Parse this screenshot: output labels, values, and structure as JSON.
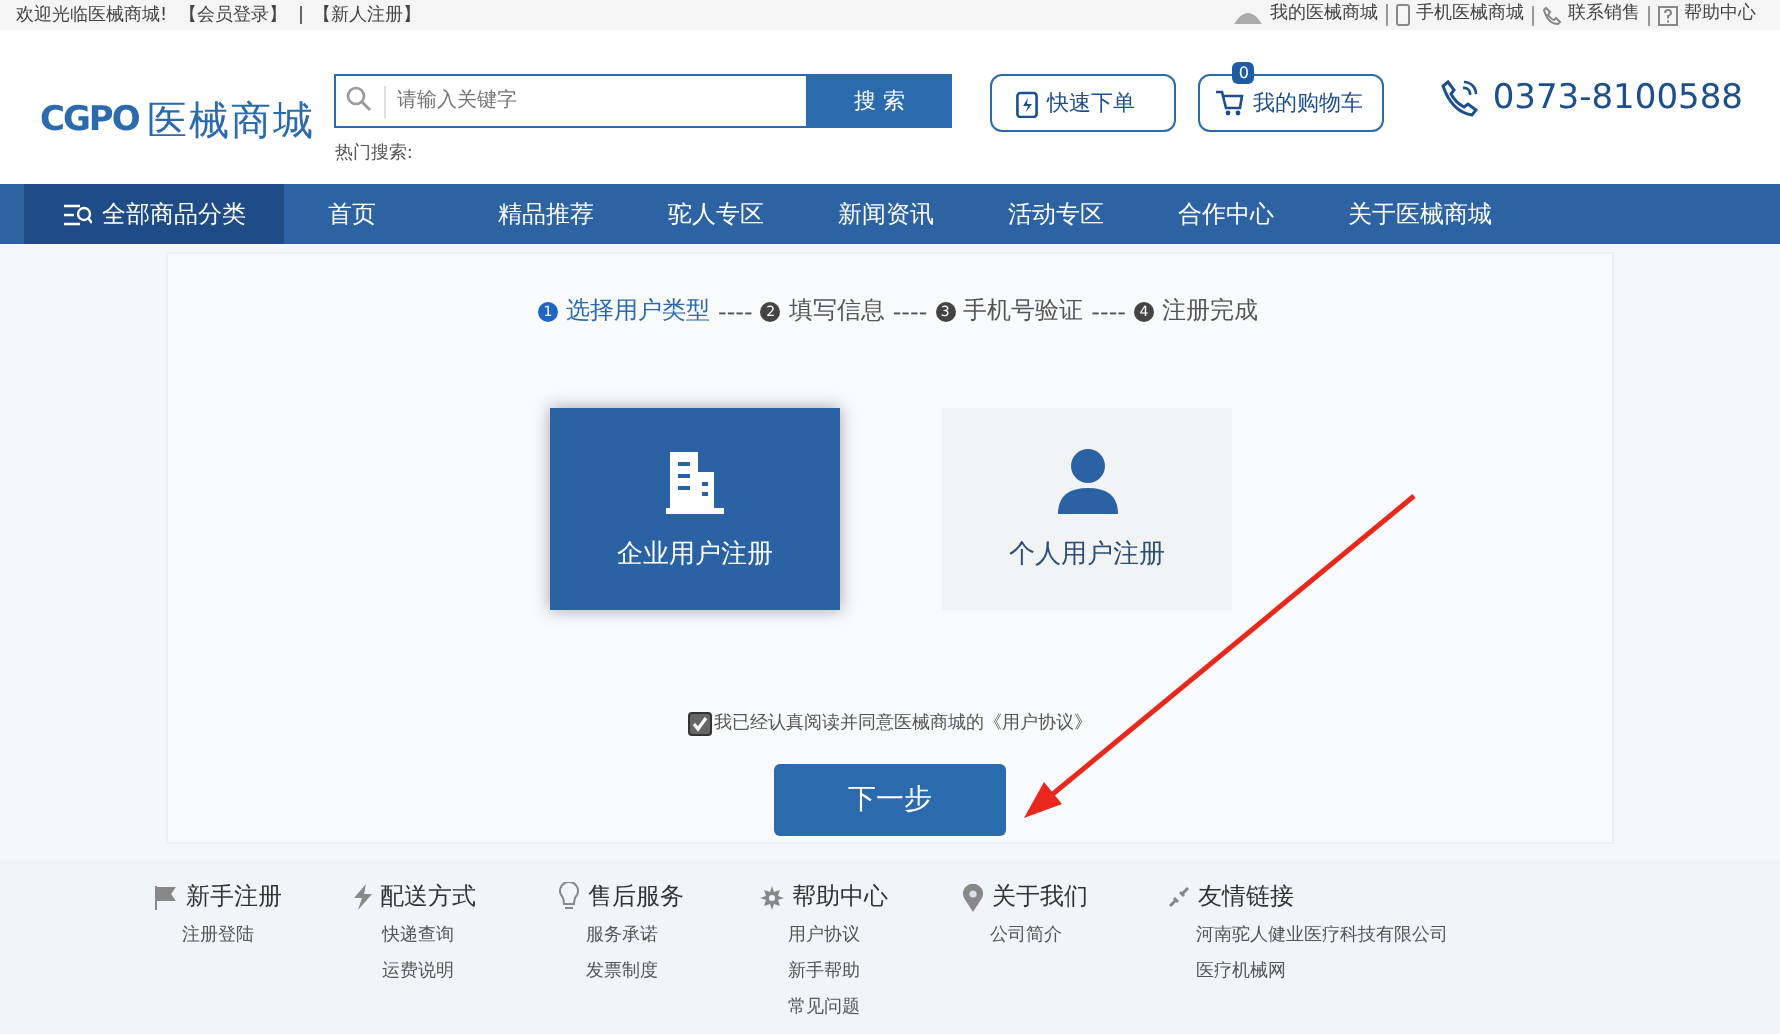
{
  "top_bar": {
    "welcome": "欢迎光临医械商城!",
    "left_links": [
      "【会员登录】",
      "【新人注册】"
    ],
    "right_links": [
      {
        "kind": "account",
        "label": "我的医械商城"
      },
      {
        "kind": "mobile",
        "label": "手机医械商城"
      },
      {
        "kind": "phone",
        "label": "联系销售"
      },
      {
        "kind": "help",
        "label": "帮助中心"
      }
    ]
  },
  "header": {
    "logo": {
      "mark": "CGPO",
      "name": "医械商城"
    },
    "search": {
      "placeholder": "请输入关键字",
      "button": "搜 索",
      "hot_label": "热门搜索:"
    },
    "quick_order": "快速下单",
    "cart": {
      "label": "我的购物车",
      "count": "0"
    },
    "phone": "0373-8100588"
  },
  "nav": {
    "category": "全部商品分类",
    "items": [
      "首页",
      "精品推荐",
      "驼人专区",
      "新闻资讯",
      "活动专区",
      "合作中心",
      "关于医械商城"
    ]
  },
  "steps": [
    {
      "number": "1",
      "label": "选择用户类型",
      "selected": true
    },
    {
      "separator": "----",
      "number": "2",
      "label": "填写信息",
      "selected": false
    },
    {
      "separator": "----",
      "number": "3",
      "label": "手机号验证",
      "selected": false
    },
    {
      "separator": "----",
      "number": "4",
      "label": "注册完成",
      "selected": false
    }
  ],
  "user_types": [
    {
      "kind": "enterprise",
      "label": "企业用户注册",
      "selected": true
    },
    {
      "kind": "personal",
      "label": "个人用户注册",
      "selected": false
    }
  ],
  "agreement": {
    "checked": true,
    "text": "我已经认真阅读并同意医械商城的《用户协议》"
  },
  "next_button": "下一步",
  "footer": [
    {
      "kind": "flag",
      "title": "新手注册",
      "links": [
        "注册登陆"
      ]
    },
    {
      "kind": "bolt",
      "title": "配送方式",
      "links": [
        "快递查询",
        "运费说明"
      ]
    },
    {
      "kind": "bulb",
      "title": "售后服务",
      "links": [
        "服务承诺",
        "发票制度"
      ]
    },
    {
      "kind": "gear",
      "title": "帮助中心",
      "links": [
        "用户协议",
        "新手帮助",
        "常见问题"
      ]
    },
    {
      "kind": "pin",
      "title": "关于我们",
      "links": [
        "公司简介"
      ]
    },
    {
      "kind": "link",
      "title": "友情链接",
      "links": [
        "河南驼人健业医疗科技有限公司",
        "医疗机械网"
      ]
    }
  ]
}
